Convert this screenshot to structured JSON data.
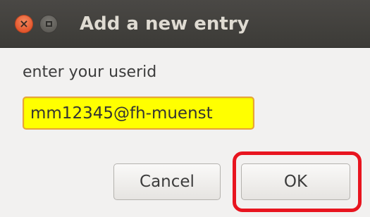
{
  "window": {
    "title": "Add a new entry",
    "close_icon": "close-icon",
    "maximize_icon": "maximize-icon"
  },
  "form": {
    "prompt": "enter your userid",
    "userid_value": "mm12345@fh-muenst"
  },
  "buttons": {
    "cancel_label": "Cancel",
    "ok_label": "OK"
  },
  "colors": {
    "input_background": "#ffff00",
    "highlight": "#e8141f"
  }
}
